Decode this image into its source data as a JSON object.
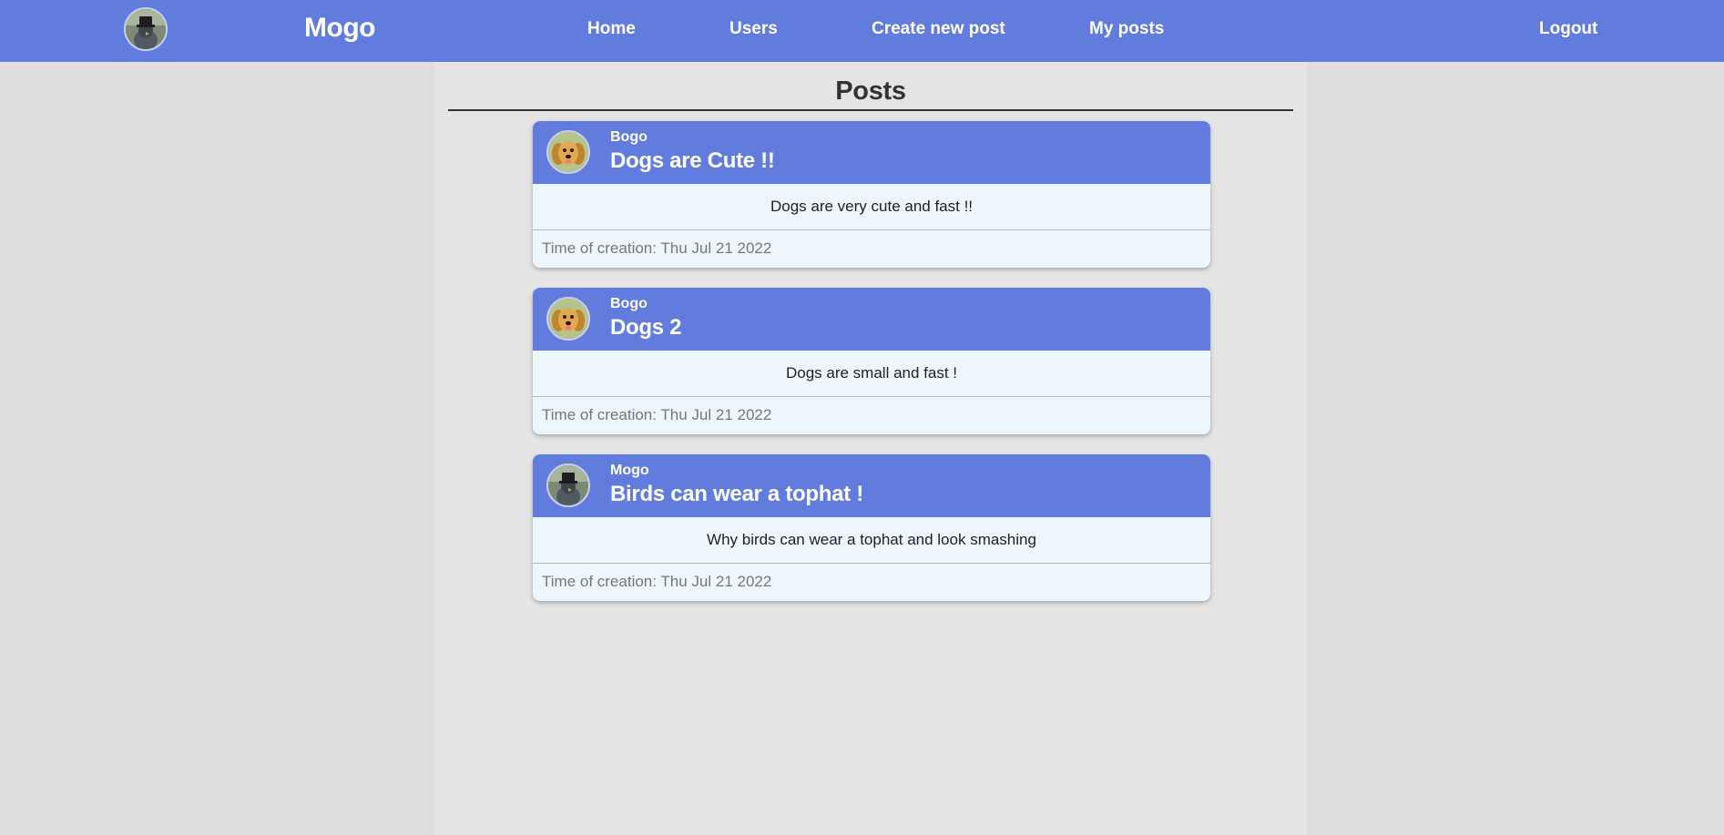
{
  "navbar": {
    "brand": "Mogo",
    "avatar_icon": "bird-tophat-avatar-icon",
    "links": {
      "home": "Home",
      "users": "Users",
      "create": "Create new post",
      "my_posts": "My posts",
      "logout": "Logout"
    }
  },
  "page": {
    "title": "Posts"
  },
  "posts": [
    {
      "author": "Bogo",
      "avatar_icon": "dog-avatar-icon",
      "title": "Dogs are Cute !!",
      "body": "Dogs are very cute and fast !!",
      "time": "Time of creation: Thu Jul 21 2022"
    },
    {
      "author": "Bogo",
      "avatar_icon": "dog-avatar-icon",
      "title": "Dogs 2",
      "body": "Dogs are small and fast !",
      "time": "Time of creation: Thu Jul 21 2022"
    },
    {
      "author": "Mogo",
      "avatar_icon": "bird-tophat-avatar-icon",
      "title": "Birds can wear a tophat !",
      "body": "Why birds can wear a tophat and look smashing",
      "time": "Time of creation: Thu Jul 21 2022"
    }
  ],
  "colors": {
    "navbar": "#617cdc",
    "card_body": "#eef6fd",
    "page_background": "#dedede",
    "content_background": "#e4e4e4",
    "timestamp": "#777777"
  }
}
